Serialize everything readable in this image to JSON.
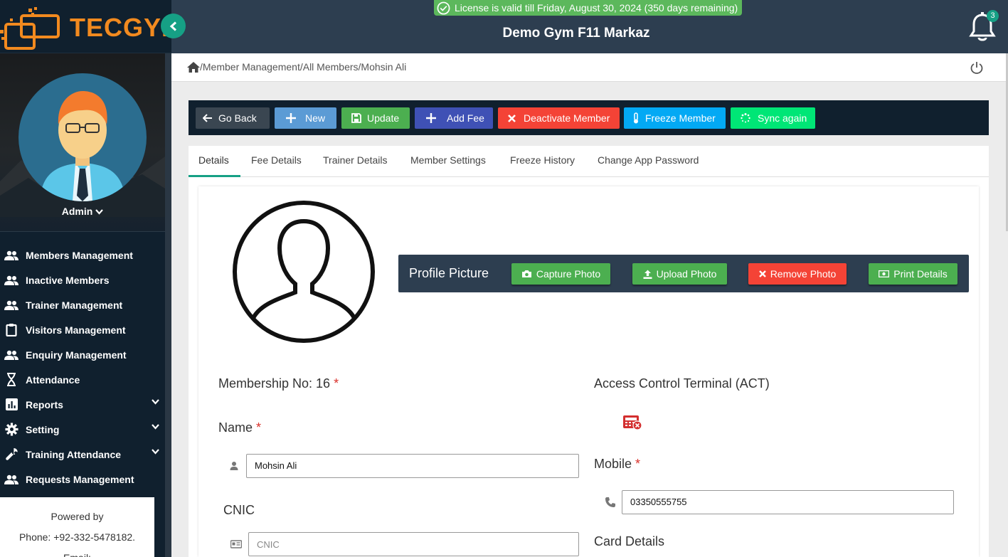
{
  "brand": {
    "logo_text": "TECGYM"
  },
  "license": {
    "text": "License is valid till Friday, August 30, 2024 (350 days remaining)"
  },
  "header": {
    "gym_name": "Demo Gym F11 Markaz",
    "notifications_count": "3"
  },
  "user": {
    "name": "Admin"
  },
  "sidebar": {
    "items": [
      {
        "label": "Members Management",
        "icon": "users-icon"
      },
      {
        "label": "Inactive Members",
        "icon": "users-icon"
      },
      {
        "label": "Trainer Management",
        "icon": "users-icon"
      },
      {
        "label": "Visitors Management",
        "icon": "clipboard-icon"
      },
      {
        "label": "Enquiry Management",
        "icon": "users-icon"
      },
      {
        "label": "Attendance",
        "icon": "hourglass-icon"
      },
      {
        "label": "Reports",
        "icon": "bar-chart-icon",
        "expandable": true
      },
      {
        "label": "Setting",
        "icon": "gear-icon",
        "expandable": true
      },
      {
        "label": "Training Attendance",
        "icon": "wrench-icon",
        "expandable": true
      },
      {
        "label": "Requests Management",
        "icon": "users-icon"
      }
    ],
    "footer": {
      "powered_by": "Powered by",
      "phone": "Phone: +92-332-5478182.",
      "email": "Email:"
    }
  },
  "breadcrumb": {
    "sep": "/",
    "items": [
      "Member Management",
      "All Members",
      "Mohsin Ali"
    ]
  },
  "toolbar": {
    "go_back": "Go Back",
    "new": "New",
    "update": "Update",
    "add_fee": "Add Fee",
    "deactivate": "Deactivate Member",
    "freeze": "Freeze Member",
    "sync": "Sync again"
  },
  "tabs": [
    "Details",
    "Fee Details",
    "Trainer Details",
    "Member Settings",
    "Freeze History",
    "Change App Password"
  ],
  "profile_picture": {
    "title": "Profile Picture",
    "capture": "Capture Photo",
    "upload": "Upload Photo",
    "remove": "Remove Photo",
    "print": "Print Details"
  },
  "form": {
    "membership_label": "Membership No: 16",
    "required_mark": "*",
    "name_label": "Name",
    "name_value": "Mohsin Ali",
    "cnic_label": "CNIC",
    "cnic_placeholder": "CNIC",
    "act_label": "Access Control Terminal (ACT)",
    "mobile_label": "Mobile",
    "mobile_value": "03350555755",
    "card_label": "Card Details"
  },
  "colors": {
    "sidebar": "#10202e",
    "header": "#2d3e50",
    "accent": "#16a085",
    "green": "#5cb85c",
    "blue": "#3f51b5",
    "red": "#f44336",
    "light_blue": "#03a9f4",
    "bright_green": "#00e676",
    "logo_orange": "#f28a1f"
  }
}
